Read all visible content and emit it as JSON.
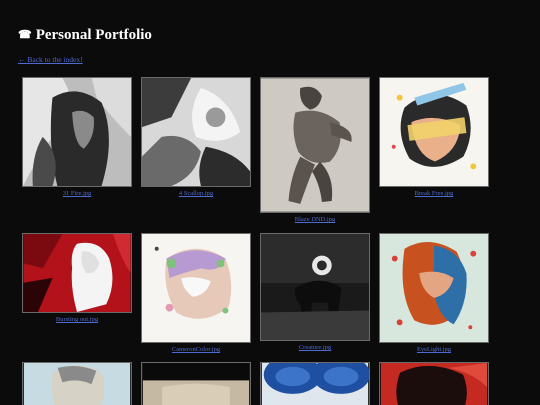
{
  "header": {
    "title": "Personal Portfolio",
    "icon": "camera-flash-icon",
    "icon_glyph": "☎"
  },
  "nav": {
    "back_label": "← Back to the index!"
  },
  "gallery": {
    "items": [
      {
        "caption": "31 Fire.jpg"
      },
      {
        "caption": "4 Scallop.jpg"
      },
      {
        "caption": "Blaze DND.jpg"
      },
      {
        "caption": "Break Free.jpg"
      },
      {
        "caption": "Bursting out.jpg"
      },
      {
        "caption": "CameronColor.jpg"
      },
      {
        "caption": "Creature.jpg"
      },
      {
        "caption": "EyeLight.jpg"
      },
      {
        "caption": ""
      },
      {
        "caption": ""
      },
      {
        "caption": ""
      },
      {
        "caption": ""
      }
    ]
  },
  "colors": {
    "background": "#0b0b0b",
    "link": "#4f6bd1",
    "title": "#ffffff"
  }
}
